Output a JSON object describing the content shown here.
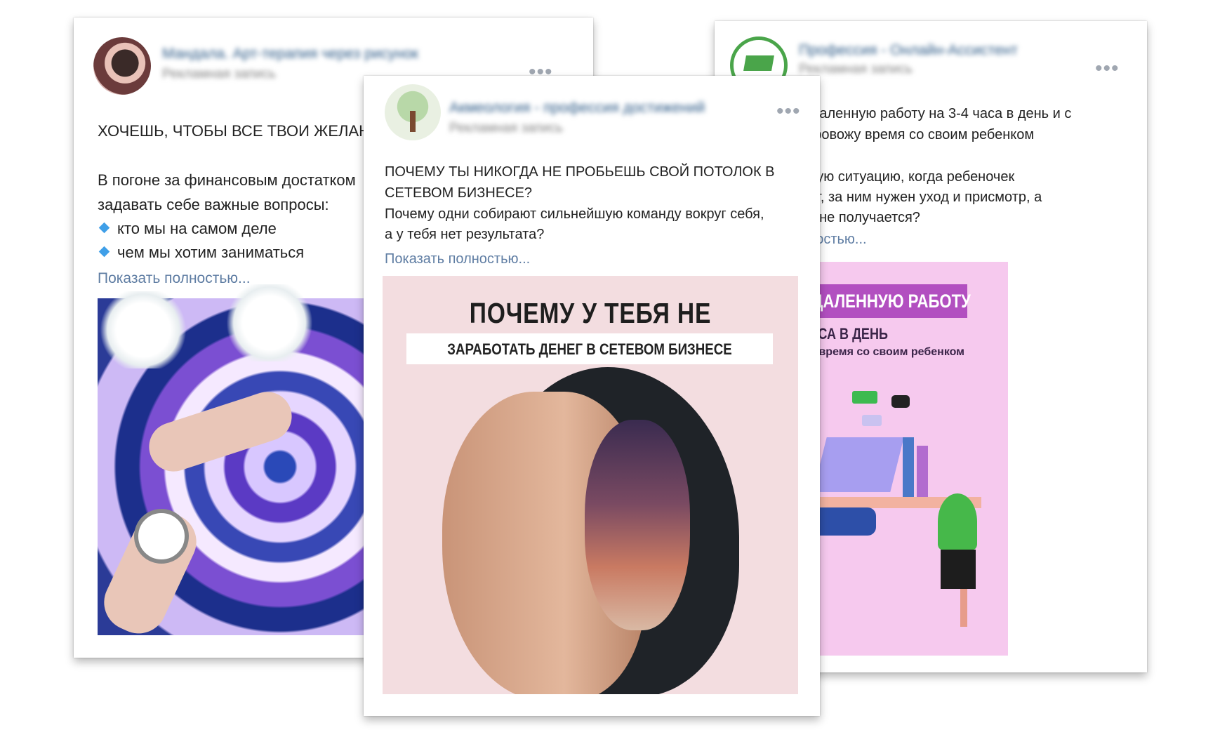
{
  "cards": {
    "left": {
      "author": "Мандала. Арт-терапия через рисунок",
      "subtitle": "Рекламная запись",
      "more": "•••",
      "text": [
        "ХОЧЕШЬ, ЧТОБЫ ВСЕ ТВОИ ЖЕЛАНИЯ",
        "В погоне за финансовым достатком",
        "задавать себе важные вопросы:"
      ],
      "bullets": [
        "кто мы на самом деле",
        "чем мы хотим заниматься"
      ],
      "show_more": "Показать полностью..."
    },
    "middle": {
      "author": "Акмеология - профессия достижений",
      "subtitle": "Рекламная запись",
      "more": "•••",
      "text": [
        "ПОЧЕМУ ТЫ НИКОГДА НЕ ПРОБЬЕШЬ СВОЙ ПОТОЛОК В",
        "СЕТЕВОМ БИЗНЕСЕ?",
        "Почему одни собирают сильнейшую команду вокруг себя,",
        "а у тебя нет результата?"
      ],
      "show_more": "Показать полностью...",
      "image": {
        "title": "ПОЧЕМУ У ТЕБЯ НЕ ПОЛУЧАЕТСЯ",
        "subtitle": "ЗАРАБОТАТЬ ДЕНЕГ В СЕТЕВОМ БИЗНЕСЕ"
      }
    },
    "right": {
      "author": "Профессия - Онлайн-Ассистент",
      "subtitle": "Рекламная запись",
      "more": "•••",
      "text": [
        "ла удаленную работу на 3-4 часа в день и с",
        "ем провожу время со своим ребенком",
        "в такую ситуацию, когда ребеночек",
        "олеет, за ним нужен уход и присмотр, а",
        "этом не получается?"
      ],
      "show_more": "полностью...",
      "image": {
        "banner": "Я НАШЛА УДАЛЕННУЮ РАБОТУ",
        "line1": "НА 3-4 ЧАСА В ДЕНЬ",
        "line2": "льствием провожу время со своим ребенком"
      }
    }
  },
  "colors": {
    "link": "#2a5885",
    "show_more": "#5f7da3",
    "meta": "#828282",
    "bullet": "#3f9fe8",
    "banner": "#b24fc0"
  }
}
